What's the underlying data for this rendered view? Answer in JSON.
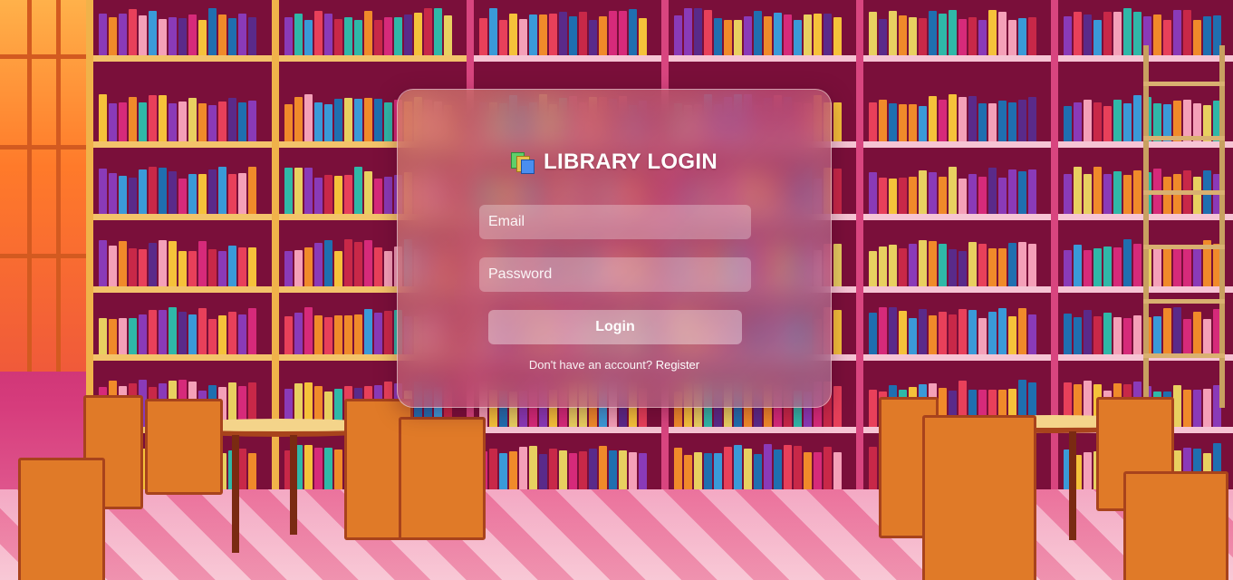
{
  "login": {
    "title": "LIBRARY LOGIN",
    "logo_icon": "books-icon",
    "email_placeholder": "Email",
    "email_value": "",
    "password_placeholder": "Password",
    "password_value": "",
    "login_label": "Login",
    "register_prompt": "Don't have an account?",
    "register_link": "Register"
  },
  "colors": {
    "card_tint": "#c86e82",
    "text": "#ffffff",
    "background_accent": "#c2306e"
  }
}
